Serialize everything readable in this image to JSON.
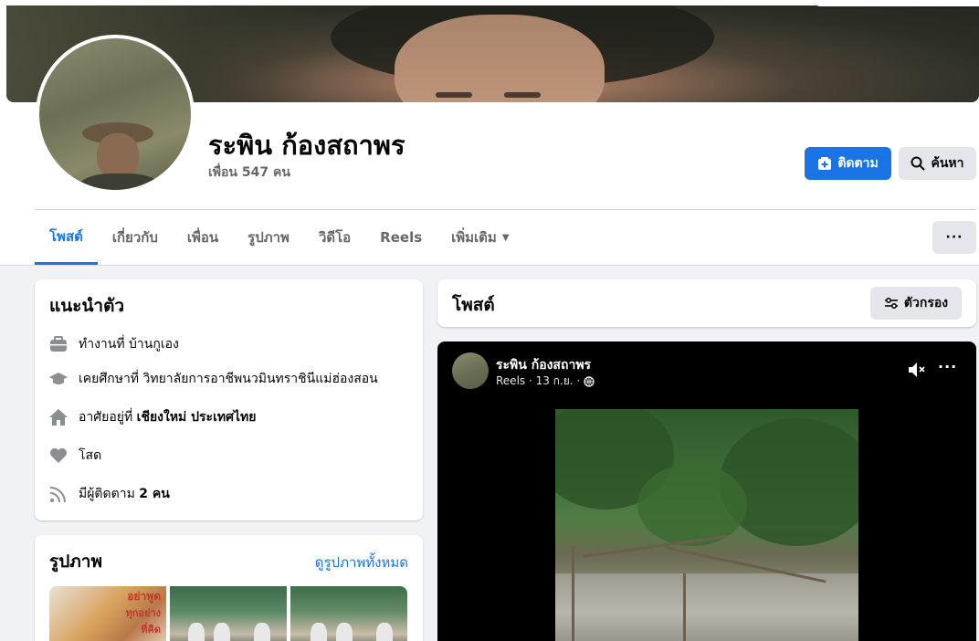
{
  "profile": {
    "name": "ระพิน ก้องสถาพร",
    "friends": "เพื่อน 547 คน",
    "follow_label": "ติดตาม",
    "search_label": "ค้นหา"
  },
  "tabs": [
    {
      "label": "โพสต์",
      "active": true
    },
    {
      "label": "เกี่ยวกับ"
    },
    {
      "label": "เพื่อน"
    },
    {
      "label": "รูปภาพ"
    },
    {
      "label": "วิดีโอ"
    },
    {
      "label": "Reels"
    },
    {
      "label": "เพิ่มเติม"
    }
  ],
  "more_menu": "···",
  "intro": {
    "title": "แนะนำตัว",
    "items": [
      {
        "icon": "briefcase-icon",
        "text": "ทำงานที่ บ้านกูเอง"
      },
      {
        "icon": "graduation-cap-icon",
        "text": "เคยศึกษาที่ วิทยาลัยการอาชีพนวมินทราชินีแม่ฮ่องสอน"
      },
      {
        "icon": "home-icon",
        "text_prefix": "อาศัยอยู่ที่ ",
        "text_bold": "เชียงใหม่ ประเทศไทย"
      },
      {
        "icon": "heart-icon",
        "text": "โสด"
      },
      {
        "icon": "rss-icon",
        "text_prefix": "มีผู้ติดตาม ",
        "text_bold": "2 คน"
      }
    ]
  },
  "photos": {
    "title": "รูปภาพ",
    "see_all": "ดูรูปภาพทั้งหมด",
    "thumb1_caption": [
      "อย่าพูด",
      "ทุกอย่าง",
      "ที่คิด"
    ]
  },
  "posts": {
    "title": "โพสต์",
    "filter_label": "ตัวกรอง"
  },
  "reel": {
    "author": "ระพิน ก้องสถาพร",
    "meta": "Reels · 13 ก.ย. ·",
    "privacy_icon": "globe-icon",
    "dots": "···"
  },
  "colors": {
    "accent": "#1b74e4",
    "background": "#f0f2f5",
    "button_gray": "#e4e6eb",
    "secondary_text": "#65676b"
  }
}
